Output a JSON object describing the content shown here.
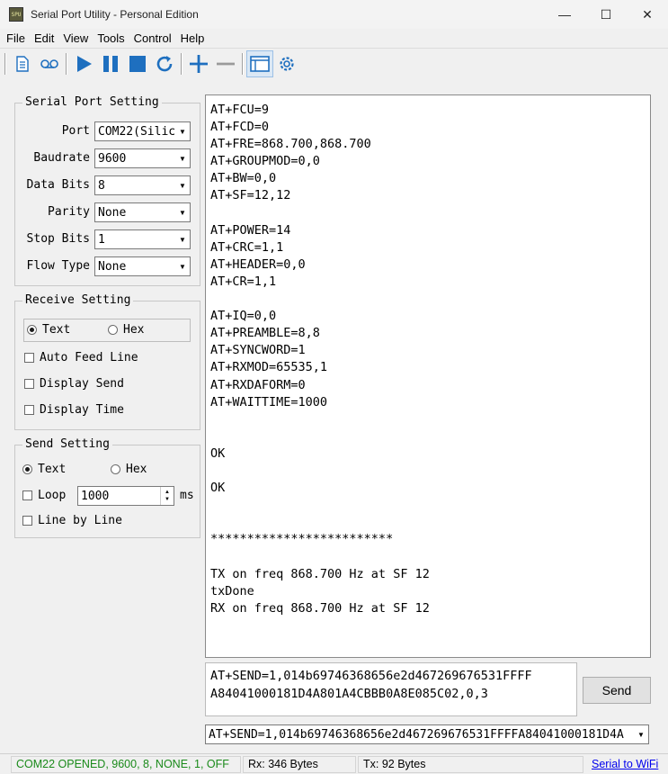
{
  "window": {
    "title": "Serial Port Utility - Personal Edition",
    "icon_text": "SPU",
    "minimize_glyph": "—",
    "maximize_glyph": "☐",
    "close_glyph": "✕"
  },
  "menu": [
    "File",
    "Edit",
    "View",
    "Tools",
    "Control",
    "Help"
  ],
  "toolbar": {
    "icons": [
      "new-document-icon",
      "tape-record-icon",
      "play-icon",
      "pause-icon",
      "stop-icon",
      "refresh-icon",
      "add-icon",
      "remove-icon",
      "window-icon",
      "settings-gear-icon"
    ],
    "accent_color": "#1e6fbf"
  },
  "serial_setting": {
    "title": "Serial Port Setting",
    "fields": [
      {
        "label": "Port",
        "value": "COM22(Silic"
      },
      {
        "label": "Baudrate",
        "value": "9600"
      },
      {
        "label": "Data Bits",
        "value": "8"
      },
      {
        "label": "Parity",
        "value": "None"
      },
      {
        "label": "Stop Bits",
        "value": "1"
      },
      {
        "label": "Flow Type",
        "value": "None"
      }
    ]
  },
  "receive_setting": {
    "title": "Receive Setting",
    "mode_text": "Text",
    "mode_hex": "Hex",
    "selected": "Text",
    "auto_feed_line": "Auto Feed Line",
    "display_send": "Display Send",
    "display_time": "Display Time"
  },
  "send_setting": {
    "title": "Send Setting",
    "mode_text": "Text",
    "mode_hex": "Hex",
    "selected": "Text",
    "loop_label": "Loop",
    "loop_value": "1000",
    "loop_unit": "ms",
    "line_by_line": "Line by Line"
  },
  "receive_lines": [
    "AT+FCU=9",
    "AT+FCD=0",
    "AT+FRE=868.700,868.700",
    "AT+GROUPMOD=0,0",
    "AT+BW=0,0",
    "AT+SF=12,12",
    "",
    "AT+POWER=14",
    "AT+CRC=1,1",
    "AT+HEADER=0,0",
    "AT+CR=1,1",
    "",
    "AT+IQ=0,0",
    "AT+PREAMBLE=8,8",
    "AT+SYNCWORD=1",
    "AT+RXMOD=65535,1",
    "AT+RXDAFORM=0",
    "AT+WAITTIME=1000",
    "",
    "",
    "OK",
    "",
    "OK",
    "",
    "",
    "*************************",
    "",
    "TX on freq 868.700 Hz at SF 12",
    "txDone",
    "RX on freq 868.700 Hz at SF 12"
  ],
  "send_text": {
    "line1": "AT+SEND=1,014b69746368656e2d467269676531FFFF",
    "line2": "A84041000181D4A801A4CBBB0A8E085C02,0,3"
  },
  "send_button": "Send",
  "history_value": "AT+SEND=1,014b69746368656e2d467269676531FFFFA84041000181D4A",
  "status": {
    "port": "COM22 OPENED, 9600, 8, NONE, 1, OFF",
    "rx": "Rx: 346 Bytes",
    "tx": "Tx: 92 Bytes",
    "link": "Serial to WiFi",
    "port_color": "#1a8a1a",
    "link_color": "#0000ee"
  }
}
